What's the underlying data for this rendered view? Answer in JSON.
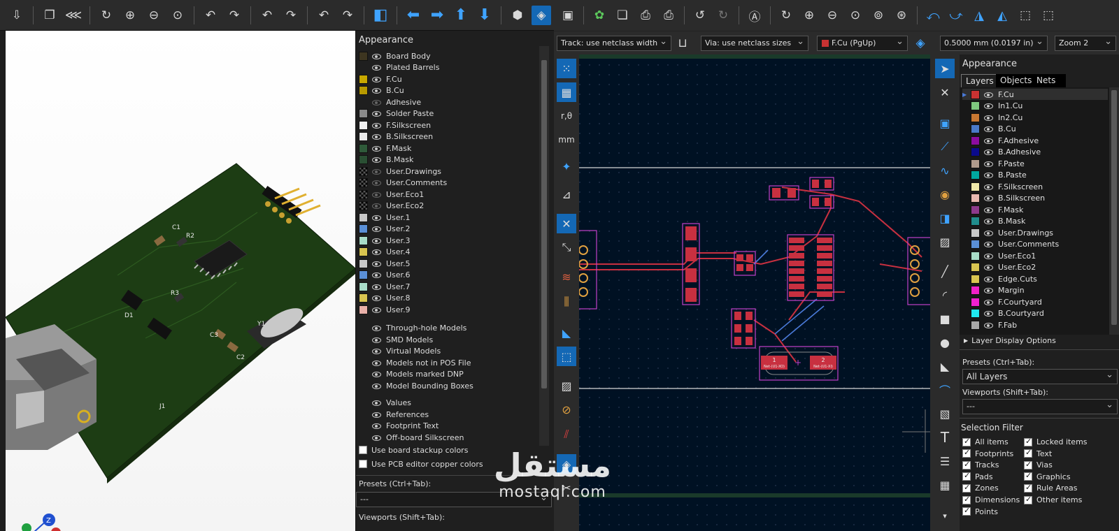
{
  "viewer3d": {
    "toolbar_icons": [
      "export-icon",
      "copy-icon",
      "raytrace-icon",
      "reload-icon",
      "zoom-in-icon",
      "zoom-out-icon",
      "zoom-fit-icon",
      "rotate-x-ccw-icon",
      "rotate-x-cw-icon",
      "rotate-y-ccw-icon",
      "rotate-y-cw-icon",
      "rotate-z-ccw-icon",
      "rotate-z-cw-icon",
      "flip-board-icon",
      "pan-left-icon",
      "pan-right-icon",
      "pan-up-icon",
      "pan-down-icon",
      "ortho-icon",
      "appearance-icon"
    ],
    "appearance": {
      "title": "Appearance",
      "layers": [
        {
          "label": "Board Body",
          "color": "#3d3520",
          "visible": true
        },
        {
          "label": "Plated Barrels",
          "color": "",
          "visible": true
        },
        {
          "label": "F.Cu",
          "color": "#c8a800",
          "visible": true
        },
        {
          "label": "B.Cu",
          "color": "#b89a00",
          "visible": true
        },
        {
          "label": "Adhesive",
          "color": "",
          "visible": false
        },
        {
          "label": "Solder Paste",
          "color": "#8a8a8a",
          "visible": true
        },
        {
          "label": "F.Silkscreen",
          "color": "#f0f0f0",
          "visible": true
        },
        {
          "label": "B.Silkscreen",
          "color": "#e8e8e8",
          "visible": true
        },
        {
          "label": "F.Mask",
          "color": "#2f5a3a",
          "visible": true
        },
        {
          "label": "B.Mask",
          "color": "#2a4f33",
          "visible": true
        },
        {
          "label": "User.Drawings",
          "color": "checker",
          "visible": false
        },
        {
          "label": "User.Comments",
          "color": "checker",
          "visible": false
        },
        {
          "label": "User.Eco1",
          "color": "checker",
          "visible": false
        },
        {
          "label": "User.Eco2",
          "color": "checker",
          "visible": false
        },
        {
          "label": "User.1",
          "color": "#c8c8c8",
          "visible": true
        },
        {
          "label": "User.2",
          "color": "#5a8fd6",
          "visible": true
        },
        {
          "label": "User.3",
          "color": "#a8dcc8",
          "visible": true
        },
        {
          "label": "User.4",
          "color": "#d8c450",
          "visible": true
        },
        {
          "label": "User.5",
          "color": "#c8c8c8",
          "visible": true
        },
        {
          "label": "User.6",
          "color": "#5a8fd6",
          "visible": true
        },
        {
          "label": "User.7",
          "color": "#a8dcc8",
          "visible": true
        },
        {
          "label": "User.8",
          "color": "#d8c450",
          "visible": true
        },
        {
          "label": "User.9",
          "color": "#e8b0a8",
          "visible": true
        }
      ],
      "models": [
        "Through-hole Models",
        "SMD Models",
        "Virtual Models",
        "Models not in POS File",
        "Models marked DNP",
        "Model Bounding Boxes"
      ],
      "texts": [
        "Values",
        "References",
        "Footprint Text",
        "Off-board Silkscreen"
      ],
      "options": [
        "Use board stackup colors",
        "Use PCB editor copper colors"
      ],
      "presets_label": "Presets (Ctrl+Tab):",
      "presets_value": "---",
      "viewports_label": "Viewports (Shift+Tab):"
    },
    "silk_refs": [
      "C1",
      "R2",
      "D1",
      "R3",
      "C3",
      "Y1",
      "C2",
      "J1"
    ]
  },
  "pcb": {
    "toolbar_icons": [
      "save-icon",
      "footprint-settings-icon",
      "page-settings-icon",
      "print-icon",
      "plot-icon",
      "undo-icon",
      "redo-icon",
      "find-icon",
      "refresh-icon",
      "zoom-in-icon",
      "zoom-out-icon",
      "zoom-fit-icon",
      "zoom-objects-icon",
      "zoom-selection-icon",
      "rotate-ccw-icon",
      "rotate-cw-icon",
      "mirror-h-icon",
      "mirror-v-icon",
      "group-icon",
      "ungroup-icon"
    ],
    "track_select": "Track: use netclass width",
    "via_select": "Via: use netclass sizes",
    "layer_select": "F.Cu (PgUp)",
    "layer_color": "#c83232",
    "grid_select": "0.5000 mm (0.0197 in)",
    "zoom_select": "Zoom 2",
    "canvas": {
      "pad_labels": [
        {
          "num": "1",
          "net": "Net-(U1-XO)"
        },
        {
          "num": "2",
          "net": "Net-(U1-XI)"
        }
      ]
    },
    "appearance": {
      "title": "Appearance",
      "tabs": [
        "Layers",
        "Objects",
        "Nets"
      ],
      "layers": [
        {
          "label": "F.Cu",
          "color": "#c83232"
        },
        {
          "label": "In1.Cu",
          "color": "#7fc87f"
        },
        {
          "label": "In2.Cu",
          "color": "#c87832"
        },
        {
          "label": "B.Cu",
          "color": "#4a7ac8"
        },
        {
          "label": "F.Adhesive",
          "color": "#8c0ca0"
        },
        {
          "label": "B.Adhesive",
          "color": "#0a0a8c"
        },
        {
          "label": "F.Paste",
          "color": "#b09a8c"
        },
        {
          "label": "B.Paste",
          "color": "#00a8a0"
        },
        {
          "label": "F.Silkscreen",
          "color": "#f0e8a8"
        },
        {
          "label": "B.Silkscreen",
          "color": "#e8b8b0"
        },
        {
          "label": "F.Mask",
          "color": "#8c3a8c"
        },
        {
          "label": "B.Mask",
          "color": "#208c8c"
        },
        {
          "label": "User.Drawings",
          "color": "#c8c8c8"
        },
        {
          "label": "User.Comments",
          "color": "#5a8fd6"
        },
        {
          "label": "User.Eco1",
          "color": "#a8dcc8"
        },
        {
          "label": "User.Eco2",
          "color": "#d8c450"
        },
        {
          "label": "Edge.Cuts",
          "color": "#d8c450"
        },
        {
          "label": "Margin",
          "color": "#f020c8"
        },
        {
          "label": "F.Courtyard",
          "color": "#f020d0"
        },
        {
          "label": "B.Courtyard",
          "color": "#20e8f0"
        },
        {
          "label": "F.Fab",
          "color": "#a8a8a8"
        }
      ],
      "layer_display_options": "Layer Display Options",
      "presets_label": "Presets (Ctrl+Tab):",
      "presets_value": "All Layers",
      "viewports_label": "Viewports (Shift+Tab):",
      "viewports_value": "---",
      "selection_filter_title": "Selection Filter",
      "filters_left": [
        "All items",
        "Footprints",
        "Tracks",
        "Pads",
        "Zones",
        "Dimensions",
        "Points"
      ],
      "filters_right": [
        "Locked items",
        "Text",
        "Vias",
        "Graphics",
        "Rule Areas",
        "Other items"
      ]
    }
  },
  "watermark": {
    "arabic": "مستقل",
    "latin": "mostaql.com"
  }
}
